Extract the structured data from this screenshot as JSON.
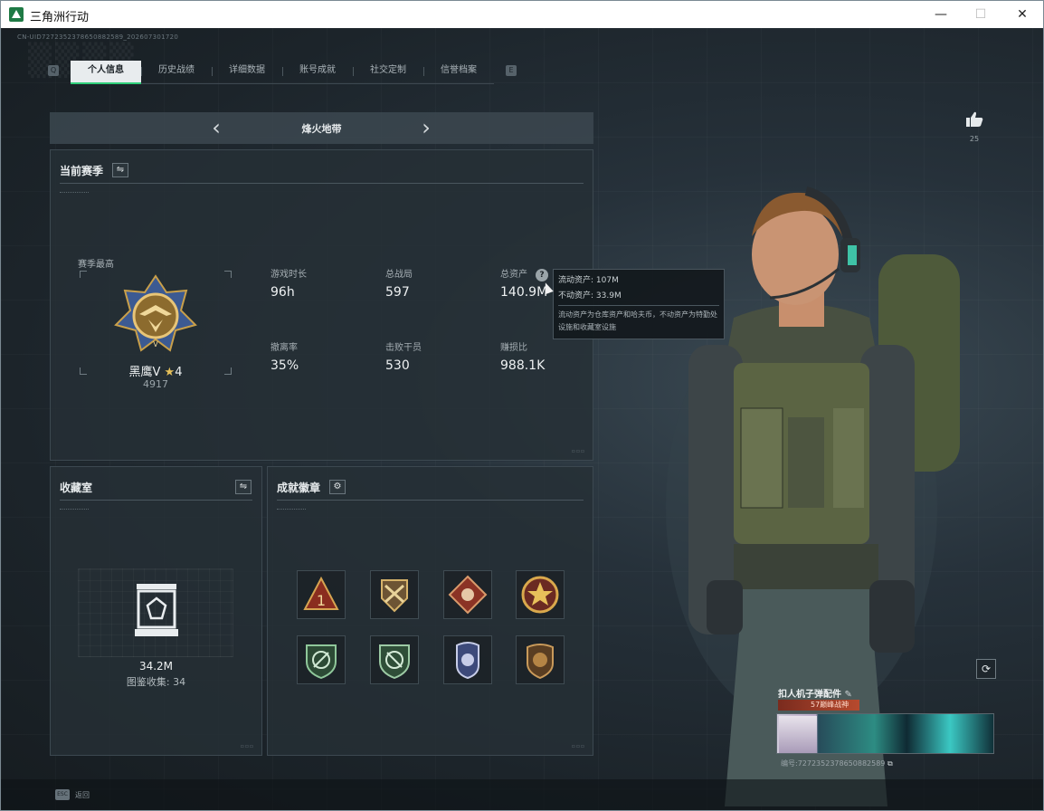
{
  "window": {
    "title": "三角洲行动",
    "minimize": "—",
    "maximize": "☐",
    "close": "✕"
  },
  "uid": "CN-UID7272352378650882589_202607301720",
  "tabs": [
    "个人信息",
    "历史战绩",
    "详细数据",
    "账号成就",
    "社交定制",
    "信誉档案"
  ],
  "tab_keys": {
    "left": "Q",
    "right": "E"
  },
  "mode": {
    "name": "烽火地带",
    "prev": "‹",
    "next": "›"
  },
  "season": {
    "title": "当前赛季",
    "best_label": "赛季最高",
    "rank_name": "黑鹰V",
    "rank_stars": "4",
    "rank_points": "4917",
    "stats": [
      {
        "label": "游戏时长",
        "value": "96h"
      },
      {
        "label": "总战局",
        "value": "597"
      },
      {
        "label": "总资产",
        "value": "140.9M"
      },
      {
        "label": "撤离率",
        "value": "35%"
      },
      {
        "label": "击败干员",
        "value": "530"
      },
      {
        "label": "赚损比",
        "value": "988.1K"
      }
    ]
  },
  "tooltip": {
    "liquid_label": "流动资产:",
    "liquid_value": "107M",
    "fixed_label": "不动资产:",
    "fixed_value": "33.9M",
    "desc": "流动资产为仓库资产和哈夫币，不动资产为特勤处设施和收藏室设施"
  },
  "vault": {
    "title": "收藏室",
    "value": "34.2M",
    "count": "图鉴收集: 34"
  },
  "achievements": {
    "title": "成就徽章"
  },
  "likes": {
    "count": "25"
  },
  "card": {
    "name": "扣人机子弹配件",
    "subtitle": "57巅峰战神",
    "id": "编号:7272352378650882589"
  },
  "footer": {
    "esc_key": "ESC",
    "esc_label": "返回"
  },
  "colors": {
    "accent": "#2fcf7a",
    "panel": "#262f36",
    "gold": "#c9a04a"
  }
}
